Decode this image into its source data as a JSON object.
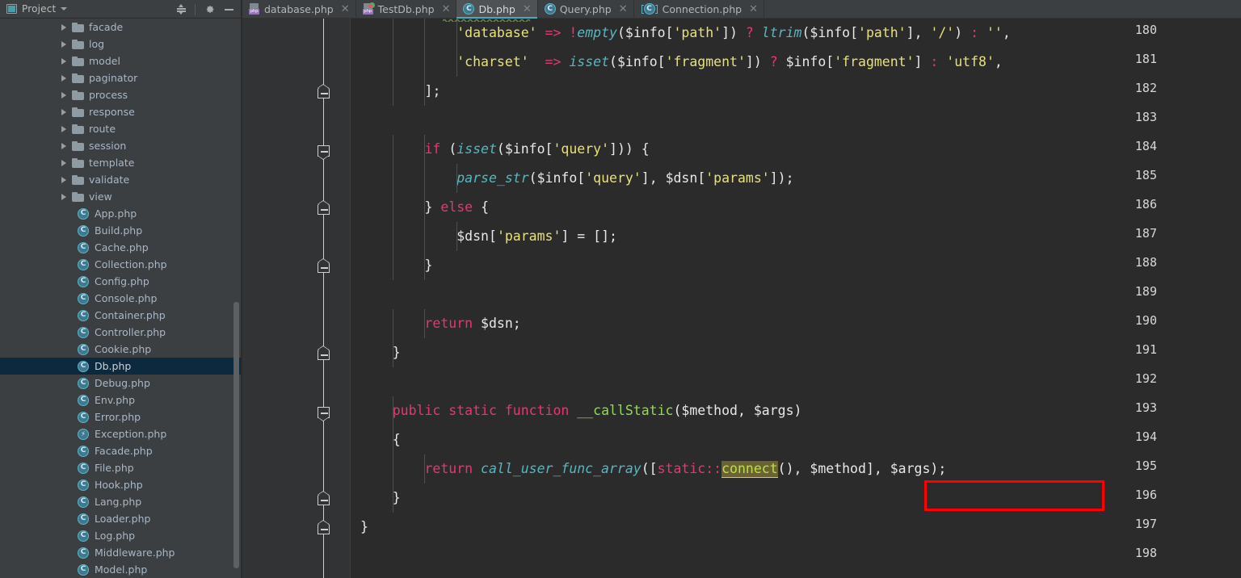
{
  "sidebar": {
    "title": "Project",
    "icons": {
      "project": "project-icon",
      "dropdown": "chevron-down-icon",
      "collapse_all": "collapse-all-icon",
      "settings": "gear-icon",
      "hide": "minimize-icon"
    },
    "tree": [
      {
        "label": "facade",
        "kind": "folder"
      },
      {
        "label": "log",
        "kind": "folder"
      },
      {
        "label": "model",
        "kind": "folder"
      },
      {
        "label": "paginator",
        "kind": "folder"
      },
      {
        "label": "process",
        "kind": "folder"
      },
      {
        "label": "response",
        "kind": "folder"
      },
      {
        "label": "route",
        "kind": "folder"
      },
      {
        "label": "session",
        "kind": "folder"
      },
      {
        "label": "template",
        "kind": "folder"
      },
      {
        "label": "validate",
        "kind": "folder"
      },
      {
        "label": "view",
        "kind": "folder"
      },
      {
        "label": "App.php",
        "kind": "class"
      },
      {
        "label": "Build.php",
        "kind": "class"
      },
      {
        "label": "Cache.php",
        "kind": "class"
      },
      {
        "label": "Collection.php",
        "kind": "class"
      },
      {
        "label": "Config.php",
        "kind": "class"
      },
      {
        "label": "Console.php",
        "kind": "class"
      },
      {
        "label": "Container.php",
        "kind": "class"
      },
      {
        "label": "Controller.php",
        "kind": "class"
      },
      {
        "label": "Cookie.php",
        "kind": "class"
      },
      {
        "label": "Db.php",
        "kind": "class",
        "selected": true
      },
      {
        "label": "Debug.php",
        "kind": "class"
      },
      {
        "label": "Env.php",
        "kind": "class"
      },
      {
        "label": "Error.php",
        "kind": "class"
      },
      {
        "label": "Exception.php",
        "kind": "exception"
      },
      {
        "label": "Facade.php",
        "kind": "class"
      },
      {
        "label": "File.php",
        "kind": "class"
      },
      {
        "label": "Hook.php",
        "kind": "class"
      },
      {
        "label": "Lang.php",
        "kind": "class"
      },
      {
        "label": "Loader.php",
        "kind": "class"
      },
      {
        "label": "Log.php",
        "kind": "class"
      },
      {
        "label": "Middleware.php",
        "kind": "class"
      },
      {
        "label": "Model.php",
        "kind": "abstract"
      }
    ]
  },
  "tabs": [
    {
      "label": "database.php",
      "icon": "php-file-icon",
      "active": false
    },
    {
      "label": "TestDb.php",
      "icon": "php-test-file-icon",
      "active": false
    },
    {
      "label": "Db.php",
      "icon": "php-class-icon",
      "active": true
    },
    {
      "label": "Query.php",
      "icon": "php-class-icon",
      "active": false
    },
    {
      "label": "Connection.php",
      "icon": "php-abstract-class-icon",
      "active": false
    }
  ],
  "editor": {
    "first_line": 180,
    "line_numbers": [
      180,
      181,
      182,
      183,
      184,
      185,
      186,
      187,
      188,
      189,
      190,
      191,
      192,
      193,
      194,
      195,
      196,
      197,
      198
    ],
    "lines": [
      "            'database' => !empty($info['path']) ? ltrim($info['path'], '/') : '',",
      "            'charset'  => isset($info['fragment']) ? $info['fragment'] : 'utf8',",
      "        ];",
      "",
      "        if (isset($info['query'])) {",
      "            parse_str($info['query'], $dsn['params']);",
      "        } else {",
      "            $dsn['params'] = [];",
      "        }",
      "",
      "        return $dsn;",
      "    }",
      "",
      "    public static function __callStatic($method, $args)",
      "    {",
      "        return call_user_func_array([static::connect(), $method], $args);",
      "    }",
      "}",
      ""
    ],
    "highlighted_token": "connect",
    "annotation": {
      "kind": "red-rectangle",
      "covers": "[static::connect(),",
      "color": "#ff0000"
    }
  },
  "colors": {
    "background": "#2b2b2b",
    "gutter": "#313335",
    "sidebar": "#3c3f41",
    "selection": "#0d293e",
    "accent": "#4fa8bb",
    "string": "#e8e07a",
    "keyword": "#e8376f",
    "function": "#56b6c2",
    "method": "#8fdc52",
    "annotation": "#ff0000",
    "token_highlight": "#6b6232"
  }
}
